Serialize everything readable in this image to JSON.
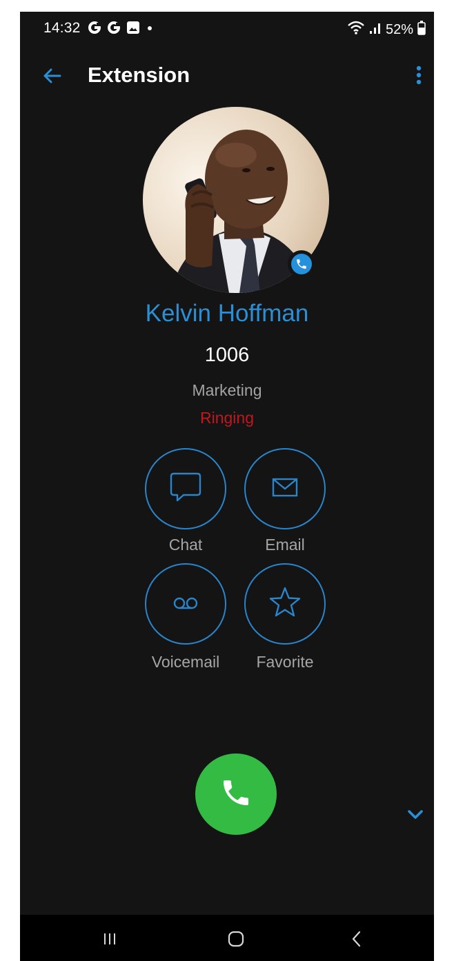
{
  "status_bar": {
    "time": "14:32",
    "notification_icons": [
      "google-g-icon",
      "google-g-icon",
      "gallery-icon",
      "dot-icon"
    ],
    "battery": "52%"
  },
  "header": {
    "title": "Extension"
  },
  "contact": {
    "name": "Kelvin Hoffman",
    "extension": "1006",
    "department": "Marketing",
    "status": "Ringing"
  },
  "actions": [
    {
      "label": "Chat",
      "icon": "chat-bubble-icon"
    },
    {
      "label": "Email",
      "icon": "envelope-icon"
    },
    {
      "label": "Voicemail",
      "icon": "voicemail-icon"
    },
    {
      "label": "Favorite",
      "icon": "star-icon"
    }
  ],
  "colors": {
    "background": "#141415",
    "accent": "#2b8fd6",
    "status_ringing": "#c3171d",
    "call_button": "#33bb43",
    "label_gray": "#a6a6a6"
  }
}
